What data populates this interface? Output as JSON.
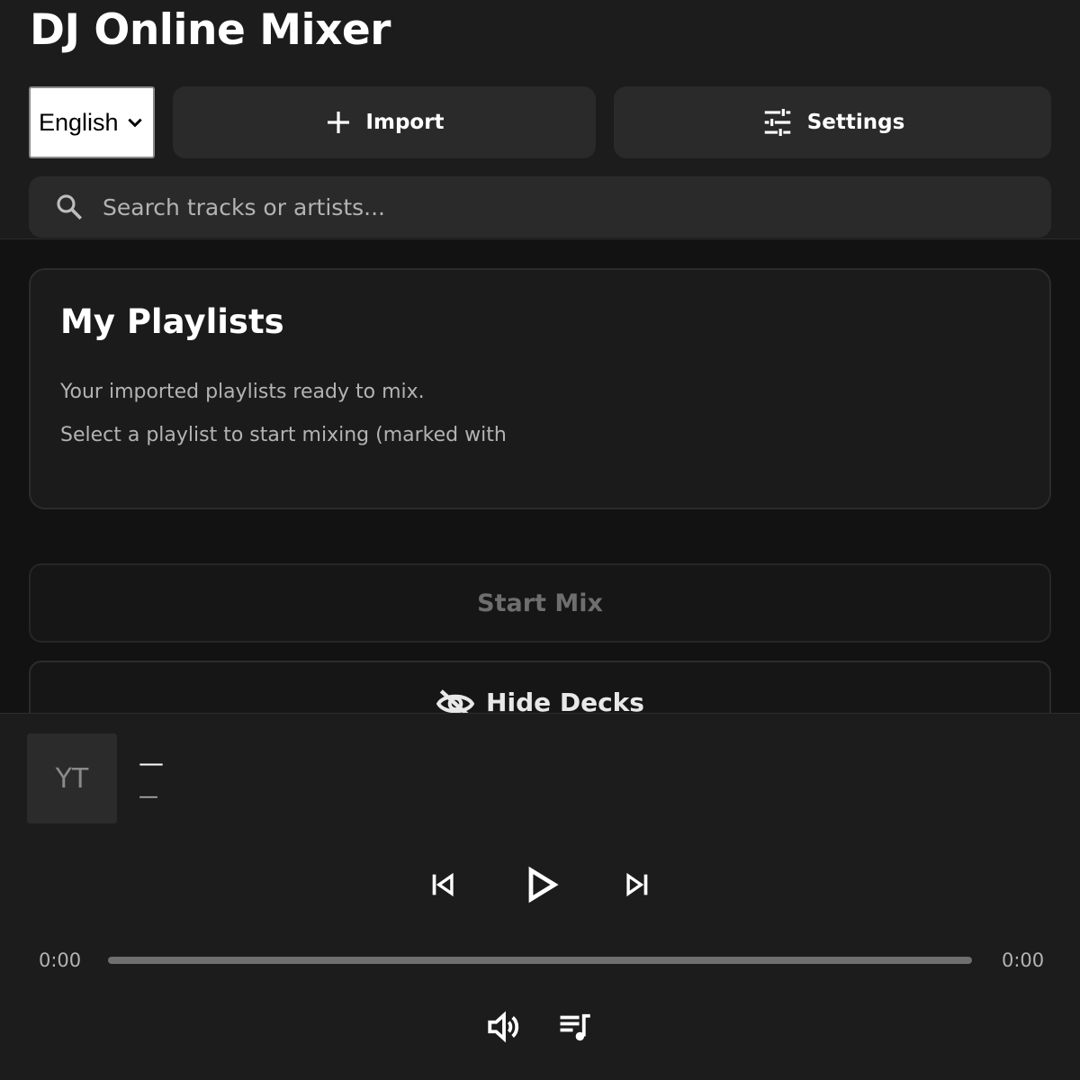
{
  "app": {
    "title": "DJ Online Mixer"
  },
  "header": {
    "language": {
      "selected": "English"
    },
    "import_label": "Import",
    "settings_label": "Settings",
    "search": {
      "placeholder": "Search tracks or artists..."
    }
  },
  "playlists": {
    "title": "My Playlists",
    "description": "Your imported playlists ready to mix.",
    "hint": "Select a playlist to start mixing (marked with"
  },
  "actions": {
    "start_mix_label": "Start Mix",
    "hide_decks_label": "Hide Decks"
  },
  "player": {
    "thumbnail_text": "YT",
    "track_title": "—",
    "track_artist": "—",
    "time_elapsed": "0:00",
    "time_total": "0:00",
    "progress_percent": 0
  },
  "icons": {
    "import": "plus-icon",
    "settings": "sliders-icon",
    "search": "search-icon",
    "hide_decks": "eye-off-icon",
    "previous": "skip-previous-icon",
    "play": "play-icon",
    "next": "skip-next-icon",
    "volume": "volume-icon",
    "queue": "queue-music-icon"
  },
  "colors": {
    "background": "#121212",
    "surface": "#1c1c1c",
    "button": "#2a2a2a",
    "text_secondary": "#b3b3b3"
  }
}
